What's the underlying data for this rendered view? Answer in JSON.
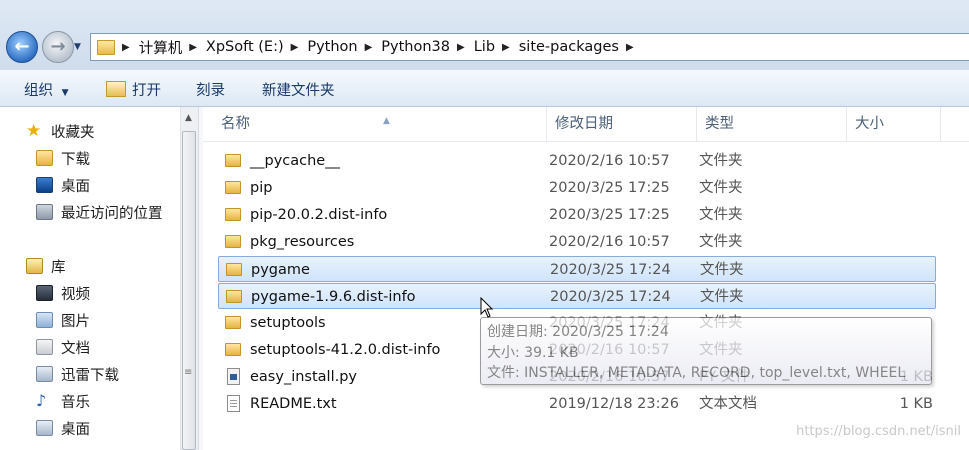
{
  "address": {
    "crumbs": [
      "计算机",
      "XpSoft (E:)",
      "Python",
      "Python38",
      "Lib",
      "site-packages"
    ]
  },
  "toolbar": {
    "organize_label": "组织",
    "open_label": "打开",
    "burn_label": "刻录",
    "new_folder_label": "新建文件夹"
  },
  "nav": {
    "favorites_label": "收藏夹",
    "favorites": [
      "下载",
      "桌面",
      "最近访问的位置"
    ],
    "library_label": "库",
    "libraries": [
      "视频",
      "图片",
      "文档",
      "迅雷下载",
      "音乐",
      "桌面"
    ]
  },
  "columns": {
    "name": "名称",
    "date": "修改日期",
    "type": "类型",
    "size": "大小"
  },
  "files": [
    {
      "name": "__pycache__",
      "date": "2020/2/16 10:57",
      "type": "文件夹",
      "size": "",
      "icon": "folder-icon"
    },
    {
      "name": "pip",
      "date": "2020/3/25 17:25",
      "type": "文件夹",
      "size": "",
      "icon": "folder-icon"
    },
    {
      "name": "pip-20.0.2.dist-info",
      "date": "2020/3/25 17:25",
      "type": "文件夹",
      "size": "",
      "icon": "folder-icon"
    },
    {
      "name": "pkg_resources",
      "date": "2020/2/16 10:57",
      "type": "文件夹",
      "size": "",
      "icon": "folder-icon"
    },
    {
      "name": "pygame",
      "date": "2020/3/25 17:24",
      "type": "文件夹",
      "size": "",
      "icon": "folder-icon"
    },
    {
      "name": "pygame-1.9.6.dist-info",
      "date": "2020/3/25 17:24",
      "type": "文件夹",
      "size": "",
      "icon": "folder-icon"
    },
    {
      "name": "setuptools",
      "date": "2020/3/25 17:24",
      "type": "文件夹",
      "size": "",
      "icon": "folder-icon"
    },
    {
      "name": "setuptools-41.2.0.dist-info",
      "date": "2020/2/16 10:57",
      "type": "文件夹",
      "size": "",
      "icon": "folder-icon"
    },
    {
      "name": "easy_install.py",
      "date": "2020/2/16 10:57",
      "type": "PY 文件",
      "size": "1 KB",
      "icon": "python-file-icon"
    },
    {
      "name": "README.txt",
      "date": "2019/12/18 23:26",
      "type": "文本文档",
      "size": "1 KB",
      "icon": "text-file-icon"
    }
  ],
  "tooltip": {
    "created": "创建日期: 2020/3/25 17:24",
    "size": "大小: 39.1 KB",
    "files": "文件: INSTALLER, METADATA, RECORD, top_level.txt, WHEEL"
  },
  "watermark": "https://blog.csdn.net/isnil"
}
